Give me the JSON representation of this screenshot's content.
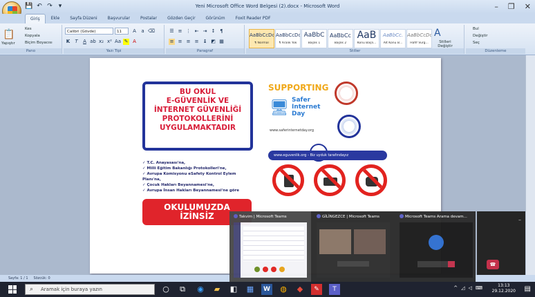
{
  "window": {
    "title": "Yeni Microsoft Office Word Belgesi (2).docx - Microsoft Word",
    "minimize": "–",
    "maximize": "❐",
    "close": "✕"
  },
  "qat": [
    "💾",
    "↶",
    "↷",
    "▾"
  ],
  "tabs": [
    "Giriş",
    "Ekle",
    "Sayfa Düzeni",
    "Başvurular",
    "Postalar",
    "Gözden Geçir",
    "Görünüm",
    "Foxit Reader PDF"
  ],
  "ribbon": {
    "clipboard": {
      "paste": "Yapıştır",
      "cut": "Kes",
      "copy": "Kopyala",
      "format_painter": "Biçim Boyacısı",
      "label": "Pano"
    },
    "font": {
      "name": "Calibri (Gövde)",
      "size": "11",
      "label": "Yazı Tipi"
    },
    "paragraph": {
      "label": "Paragraf"
    },
    "styles": {
      "items": [
        {
          "sample": "AaBbCcDc",
          "name": "¶ Normal"
        },
        {
          "sample": "AaBbCcDc",
          "name": "¶ Aralık Yok"
        },
        {
          "sample": "AaBbC",
          "name": "Başlık 1"
        },
        {
          "sample": "AaBbCc",
          "name": "Başlık 2"
        },
        {
          "sample": "AaB",
          "name": "Konu Başlı..."
        },
        {
          "sample": "AaBbCc.",
          "name": "Alt Konu B..."
        },
        {
          "sample": "AaBbCcDc",
          "name": "Hafif Vurg..."
        }
      ],
      "change": "Stilleri Değiştir",
      "label": "Stiller"
    },
    "editing": {
      "find": "Bul",
      "replace": "Değiştir",
      "select": "Seç",
      "label": "Düzenleme"
    }
  },
  "poster": {
    "headline": [
      "BU OKUL",
      "E-GÜVENLİK VE",
      "İNTERNET GÜVENLİĞİ",
      "PROTOKOLLERİNİ",
      "UYGULAMAKTADIR"
    ],
    "supporting": "SUPPORTING",
    "sid": [
      "Safer",
      "Internet",
      "Day"
    ],
    "url": "www.saferinternetday.org",
    "banner": "www.eguvenlik.org  -  Biz uyduk tarafındayız",
    "bullets": [
      "✓ T.C. Anayasası'na,",
      "✓ Milli Eğitim Bakanlığı Protokolleri'ne,",
      "✓ Avrupa Komisyonu eSafety Kontrol Eylem",
      "   Planı'na,",
      "✓ Çocuk Hakları Beyannamesi'ne,",
      "✓ Avrupa İnsan Hakları Beyannamesi'ne göre"
    ],
    "footer": [
      "OKULUMUZDA",
      "İZİNSİZ"
    ]
  },
  "status": {
    "page": "Sayfa: 1 / 1",
    "words": "Sözcük: 0"
  },
  "taskbar": {
    "search_placeholder": "Aramak için buraya yazın",
    "time": "13:13",
    "date": "29.12.2020"
  },
  "thumbs": [
    {
      "title": "Takvim | Microsoft Teams"
    },
    {
      "title": "GİLİNGEZCE | Microsoft Teams"
    },
    {
      "title": "Microsoft Teams Arama devam..."
    }
  ],
  "colors": {
    "accent_red": "#e0242b",
    "poster_blue": "#22339a",
    "taskbar": "#1f2330"
  }
}
